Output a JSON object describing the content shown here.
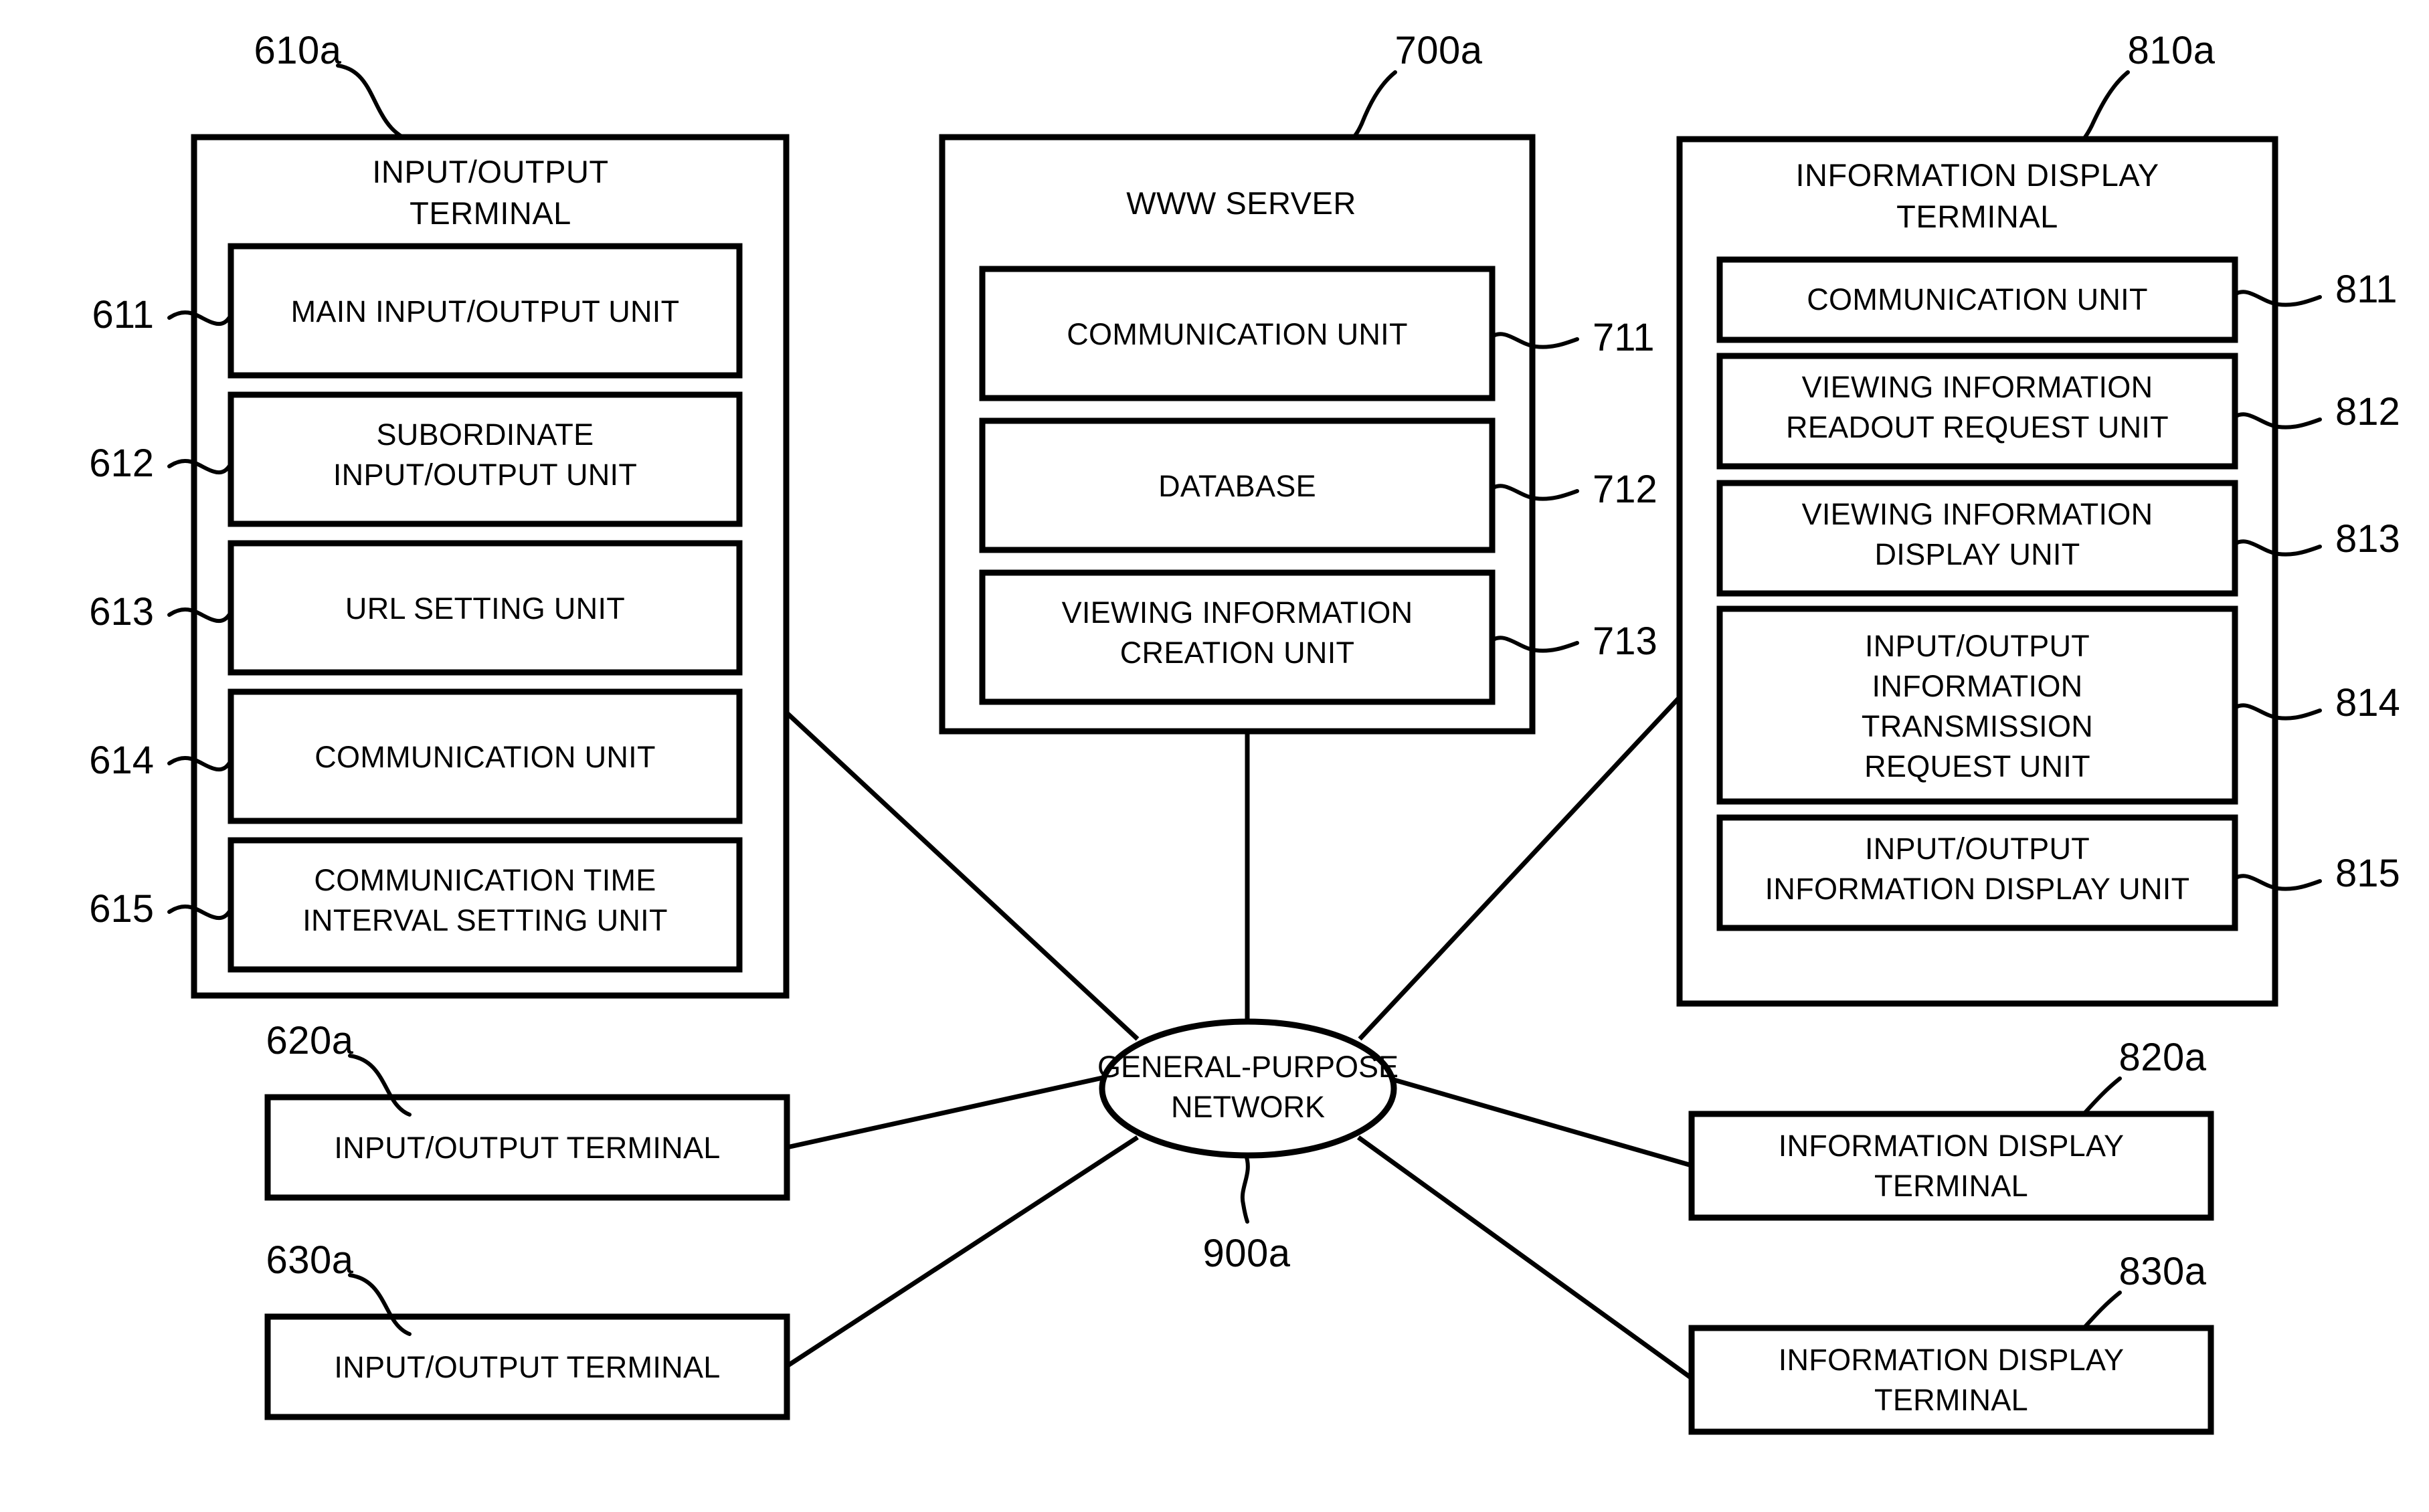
{
  "figure": {
    "kind": "patent-block-diagram",
    "background_color": "#ffffff",
    "line_color": "#000000"
  },
  "panels": {
    "input_output_terminal": {
      "ref": "610a",
      "title_line1": "INPUT/OUTPUT",
      "title_line2": "TERMINAL",
      "units": [
        {
          "ref": "611",
          "line1": "MAIN INPUT/OUTPUT UNIT",
          "line2": ""
        },
        {
          "ref": "612",
          "line1": "SUBORDINATE",
          "line2": "INPUT/OUTPUT UNIT"
        },
        {
          "ref": "613",
          "line1": "URL SETTING UNIT",
          "line2": ""
        },
        {
          "ref": "614",
          "line1": "COMMUNICATION UNIT",
          "line2": ""
        },
        {
          "ref": "615",
          "line1": "COMMUNICATION TIME",
          "line2": "INTERVAL SETTING UNIT"
        }
      ]
    },
    "www_server": {
      "ref": "700a",
      "title_line1": "WWW SERVER",
      "title_line2": "",
      "units": [
        {
          "ref": "711",
          "line1": "COMMUNICATION UNIT",
          "line2": ""
        },
        {
          "ref": "712",
          "line1": "DATABASE",
          "line2": ""
        },
        {
          "ref": "713",
          "line1": "VIEWING INFORMATION",
          "line2": "CREATION UNIT"
        }
      ]
    },
    "information_display_terminal": {
      "ref": "810a",
      "title_line1": "INFORMATION DISPLAY",
      "title_line2": "TERMINAL",
      "units": [
        {
          "ref": "811",
          "line1": "COMMUNICATION UNIT",
          "line2": "",
          "line3": "",
          "line4": ""
        },
        {
          "ref": "812",
          "line1": "VIEWING INFORMATION",
          "line2": "READOUT REQUEST UNIT",
          "line3": "",
          "line4": ""
        },
        {
          "ref": "813",
          "line1": "VIEWING INFORMATION",
          "line2": "DISPLAY UNIT",
          "line3": "",
          "line4": ""
        },
        {
          "ref": "814",
          "line1": "INPUT/OUTPUT",
          "line2": "INFORMATION",
          "line3": "TRANSMISSION",
          "line4": "REQUEST UNIT"
        },
        {
          "ref": "815",
          "line1": "INPUT/OUTPUT",
          "line2": "INFORMATION DISPLAY UNIT",
          "line3": "",
          "line4": ""
        }
      ]
    }
  },
  "network": {
    "ref": "900a",
    "label_line1": "GENERAL-PURPOSE",
    "label_line2": "NETWORK"
  },
  "secondary_terminals": [
    {
      "ref": "620a",
      "line1": "INPUT/OUTPUT TERMINAL",
      "line2": "",
      "side": "left"
    },
    {
      "ref": "630a",
      "line1": "INPUT/OUTPUT TERMINAL",
      "line2": "",
      "side": "left"
    },
    {
      "ref": "820a",
      "line1": "INFORMATION DISPLAY",
      "line2": "TERMINAL",
      "side": "right"
    },
    {
      "ref": "830a",
      "line1": "INFORMATION DISPLAY",
      "line2": "TERMINAL",
      "side": "right"
    }
  ]
}
